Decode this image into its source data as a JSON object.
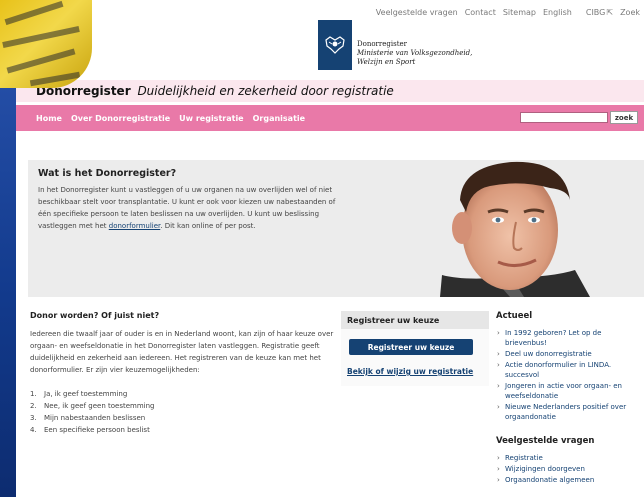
{
  "topbar": {
    "links": [
      "Veelgestelde vragen",
      "Contact",
      "Sitemap",
      "English",
      "CIBG",
      "Zoek"
    ]
  },
  "logo": {
    "line1": "Donorregister",
    "line2": "Ministerie van Volksgezondheid,",
    "line3": "Welzijn en Sport"
  },
  "header": {
    "title_bold": "Donorregister",
    "title_italic": "Duidelijkheid en zekerheid door registratie"
  },
  "nav": {
    "items": [
      "Home",
      "Over Donorregistratie",
      "Uw registratie",
      "Organisatie"
    ],
    "search_placeholder": "",
    "search_button": "zoek"
  },
  "hero": {
    "heading": "Wat is het Donorregister?",
    "intro_text": "In het Donorregister kunt u vastleggen of u uw organen na uw overlijden wel of niet beschikbaar stelt voor transplantatie. U kunt er ook voor kiezen uw nabestaanden of één specifieke persoon te laten beslissen na uw overlijden. U kunt uw beslissing vastleggen met het ",
    "intro_link": "donorformulier",
    "intro_tail": ". Dit kan online of per post."
  },
  "donor": {
    "heading": "Donor worden? Of juist niet?",
    "body": "Iedereen die twaalf jaar of ouder is en in Nederland woont, kan zijn of haar keuze over orgaan- en weefseldonatie in het Donorregister laten vastleggen. Registratie geeft duidelijkheid en zekerheid aan iedereen. Het registreren van de keuze kan met het donorformulier. Er zijn vier keuzemogelijkheden:",
    "choices": [
      {
        "num": "1.",
        "text": "Ja, ik geef toestemming"
      },
      {
        "num": "2.",
        "text": "Nee, ik geef geen toestemming"
      },
      {
        "num": "3.",
        "text": "Mijn nabestaanden beslissen"
      },
      {
        "num": "4.",
        "text": "Een specifieke persoon beslist"
      }
    ]
  },
  "register": {
    "title": "Registreer uw keuze",
    "button": "Registreer uw keuze",
    "link": "Bekijk of wijzig uw registratie"
  },
  "actueel": {
    "heading": "Actueel",
    "items": [
      "In 1992 geboren? Let op de brievenbus!",
      "Deel uw donorregistratie",
      "Actie donorformulier in LINDA. succesvol",
      "Jongeren in actie voor orgaan- en weefseldonatie",
      "Nieuwe Nederlanders positief over orgaandonatie"
    ]
  },
  "faq": {
    "heading": "Veelgestelde vragen",
    "items": [
      "Registratie",
      "Wijzigingen doorgeven",
      "Orgaandonatie algemeen"
    ]
  },
  "colors": {
    "nav_pink": "#e979a8",
    "title_pink": "#fbe7ee",
    "rijks_blue": "#154273"
  },
  "icons": [
    "rijksoverheid-logo-icon",
    "external-link-icon",
    "chevron-right-icon"
  ]
}
